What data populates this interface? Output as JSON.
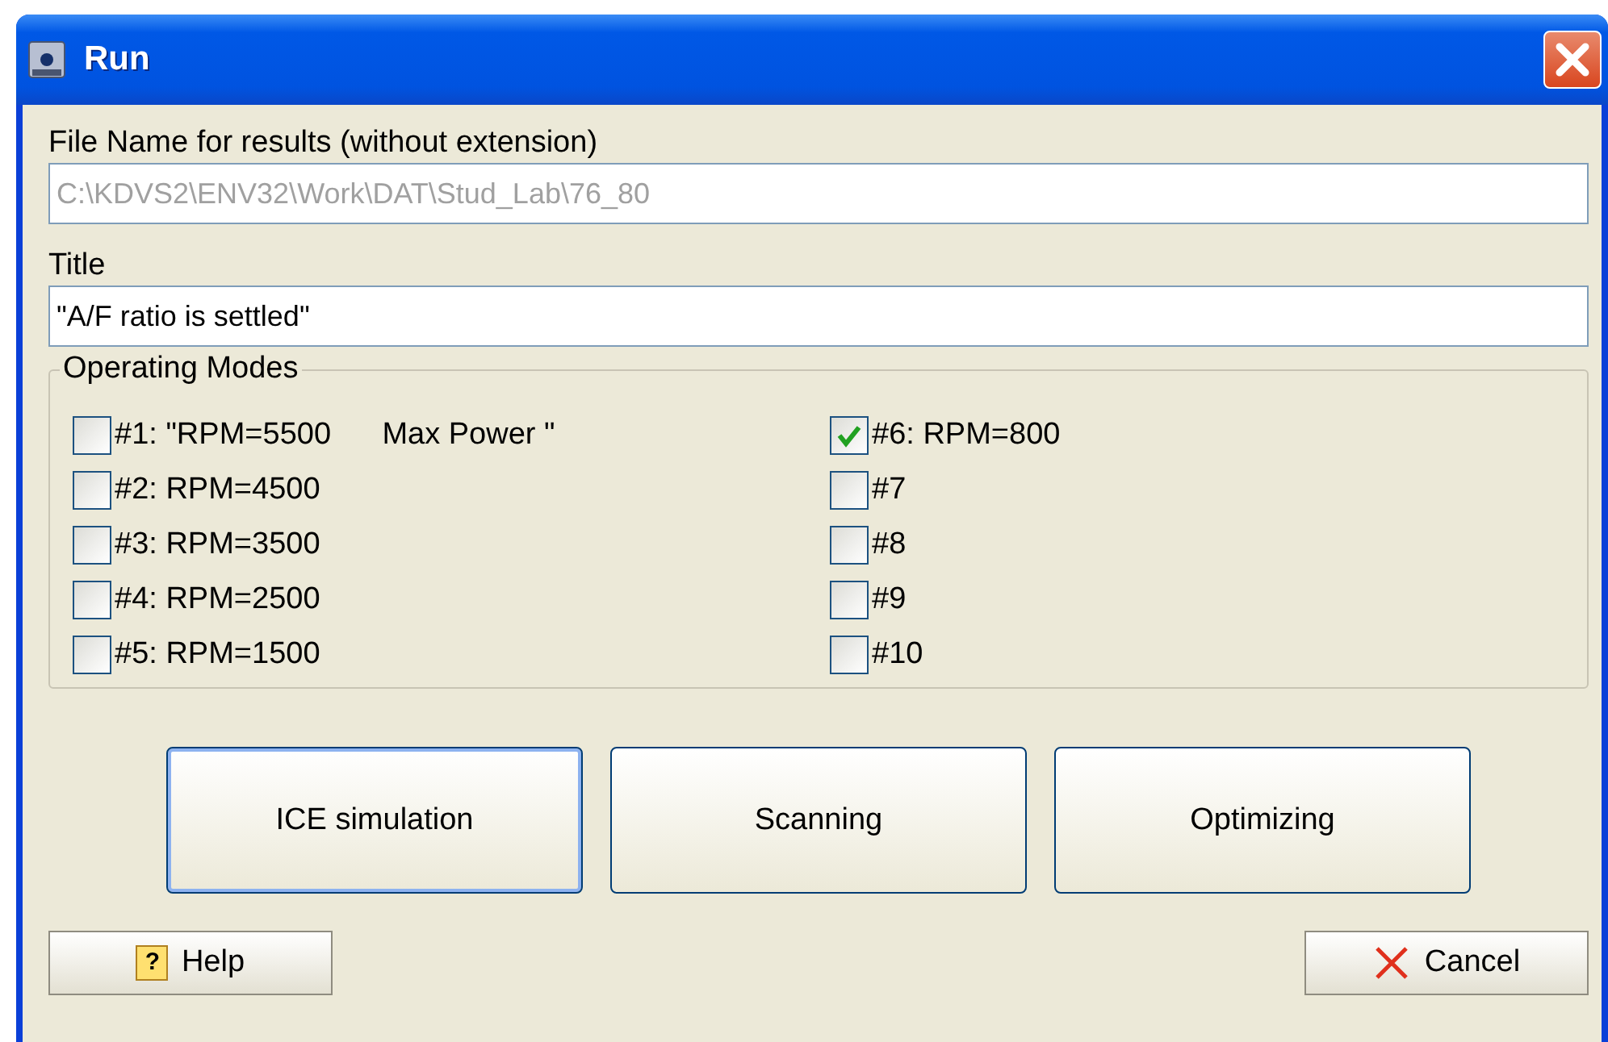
{
  "window": {
    "title": "Run"
  },
  "file_name": {
    "label": "File Name for results (without extension)",
    "value": "C:\\KDVS2\\ENV32\\Work\\DAT\\Stud_Lab\\76_80",
    "disabled": true
  },
  "title_field": {
    "label": "Title",
    "value": "\"A/F ratio is settled\"",
    "disabled": false
  },
  "operating_modes": {
    "label": "Operating Modes",
    "columns": [
      [
        {
          "label": "#1: \"RPM=5500      Max Power \"",
          "checked": false
        },
        {
          "label": "#2: RPM=4500",
          "checked": false
        },
        {
          "label": "#3: RPM=3500",
          "checked": false
        },
        {
          "label": "#4: RPM=2500",
          "checked": false
        },
        {
          "label": "#5: RPM=1500",
          "checked": false
        }
      ],
      [
        {
          "label": "#6: RPM=800",
          "checked": true
        },
        {
          "label": "#7",
          "checked": false
        },
        {
          "label": "#8",
          "checked": false
        },
        {
          "label": "#9",
          "checked": false
        },
        {
          "label": "#10",
          "checked": false
        }
      ]
    ]
  },
  "actions": [
    {
      "label": "ICE simulation",
      "selected": true
    },
    {
      "label": "Scanning",
      "selected": false
    },
    {
      "label": "Optimizing",
      "selected": false
    }
  ],
  "help_button": {
    "icon": "?",
    "label": "Help"
  },
  "cancel_button": {
    "label": "Cancel"
  }
}
